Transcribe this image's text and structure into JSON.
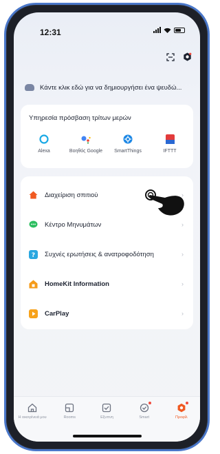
{
  "status_bar": {
    "time": "12:31"
  },
  "banner": {
    "text": "Κάντε κλικ εδώ για να δημιουργήσει ένα ψευδώ..."
  },
  "third_party": {
    "title": "Υπηρεσία πρόσβαση τρίτων μερών",
    "services": [
      {
        "label": "Alexa",
        "icon": "alexa-icon",
        "color": "#19a9e5"
      },
      {
        "label": "Βοηθός Google",
        "icon": "google-assistant-icon",
        "color": "#4285f4"
      },
      {
        "label": "SmartThings",
        "icon": "smartthings-icon",
        "color": "#1e88e5"
      },
      {
        "label": "IFTTT",
        "icon": "ifttt-icon",
        "color": "#e33b3b"
      }
    ]
  },
  "menu": {
    "items": [
      {
        "label": "Διαχείριση σπιτιού",
        "icon": "home-icon",
        "color": "#f05a22"
      },
      {
        "label": "Κέντρο Μηνυμάτων",
        "icon": "message-icon",
        "color": "#2dbe60"
      },
      {
        "label": "Συχνές ερωτήσεις & ανατροφοδότηση",
        "icon": "help-icon",
        "color": "#2aa7e0"
      },
      {
        "label": "HomeKit Information",
        "icon": "homekit-icon",
        "color": "#f59b1a"
      },
      {
        "label": "CarPlay",
        "icon": "carplay-icon",
        "color": "#f7a21b"
      }
    ]
  },
  "tabbar": {
    "tabs": [
      {
        "label": "Η οικογένειά μου",
        "icon": "home-tab-icon",
        "active": false
      },
      {
        "label": "Rooms",
        "icon": "rooms-tab-icon",
        "active": false
      },
      {
        "label": "Εξυπνη",
        "icon": "smart-tab-icon",
        "active": false
      },
      {
        "label": "Smart",
        "icon": "smart2-tab-icon",
        "active": false
      },
      {
        "label": "Προφίλ",
        "icon": "profile-tab-icon",
        "active": true
      }
    ]
  },
  "colors": {
    "accent": "#f05a22",
    "frame": "#4a77c9"
  }
}
